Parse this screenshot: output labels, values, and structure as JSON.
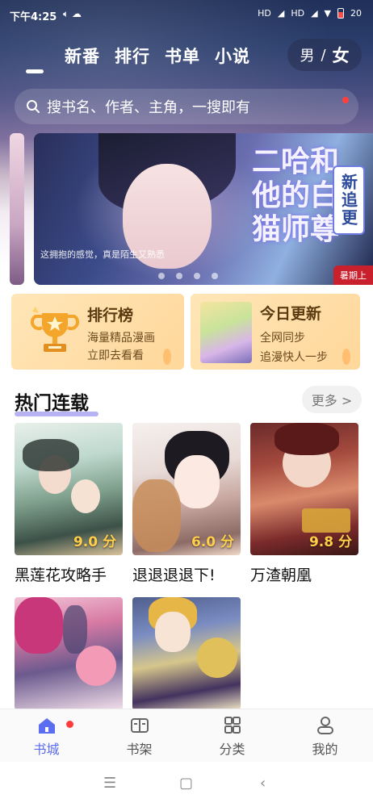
{
  "status_bar": {
    "time": "下午4:25",
    "network_1": "HD",
    "network_2": "HD",
    "battery": "20"
  },
  "top_nav": {
    "tabs": [
      {
        "label": "新番"
      },
      {
        "label": "排行"
      },
      {
        "label": "书单"
      },
      {
        "label": "小说"
      }
    ],
    "gender": {
      "male": "男",
      "divider": "/",
      "female": "女"
    }
  },
  "search": {
    "placeholder": "搜书名、作者、主角，一搜即有"
  },
  "banner": {
    "title_art": "二哈和他的白猫师尊",
    "tag": "新追更",
    "quote": "这拥抱的感觉，真是陌生又熟悉",
    "corner_label": "暑期上"
  },
  "features": [
    {
      "title": "排行榜",
      "line1": "海量精品漫画",
      "line2": "立即去看看"
    },
    {
      "title": "今日更新",
      "line1": "全网同步",
      "line2": "追漫快人一步"
    }
  ],
  "section": {
    "title": "热门连载",
    "more": "更多 >"
  },
  "comics": [
    {
      "name": "黑莲花攻略手",
      "score": "9.0 分"
    },
    {
      "name": "退退退退下!",
      "score": "6.0 分"
    },
    {
      "name": "万渣朝凰",
      "score": "9.8 分"
    },
    {
      "name": "",
      "score": ""
    },
    {
      "name": "",
      "score": ""
    }
  ],
  "tabbar": {
    "items": [
      {
        "label": "书城"
      },
      {
        "label": "书架"
      },
      {
        "label": "分类"
      },
      {
        "label": "我的"
      }
    ]
  },
  "colors": {
    "accent": "#5b6df0",
    "score": "#ffcf4a",
    "badge": "#ff3b3b"
  }
}
